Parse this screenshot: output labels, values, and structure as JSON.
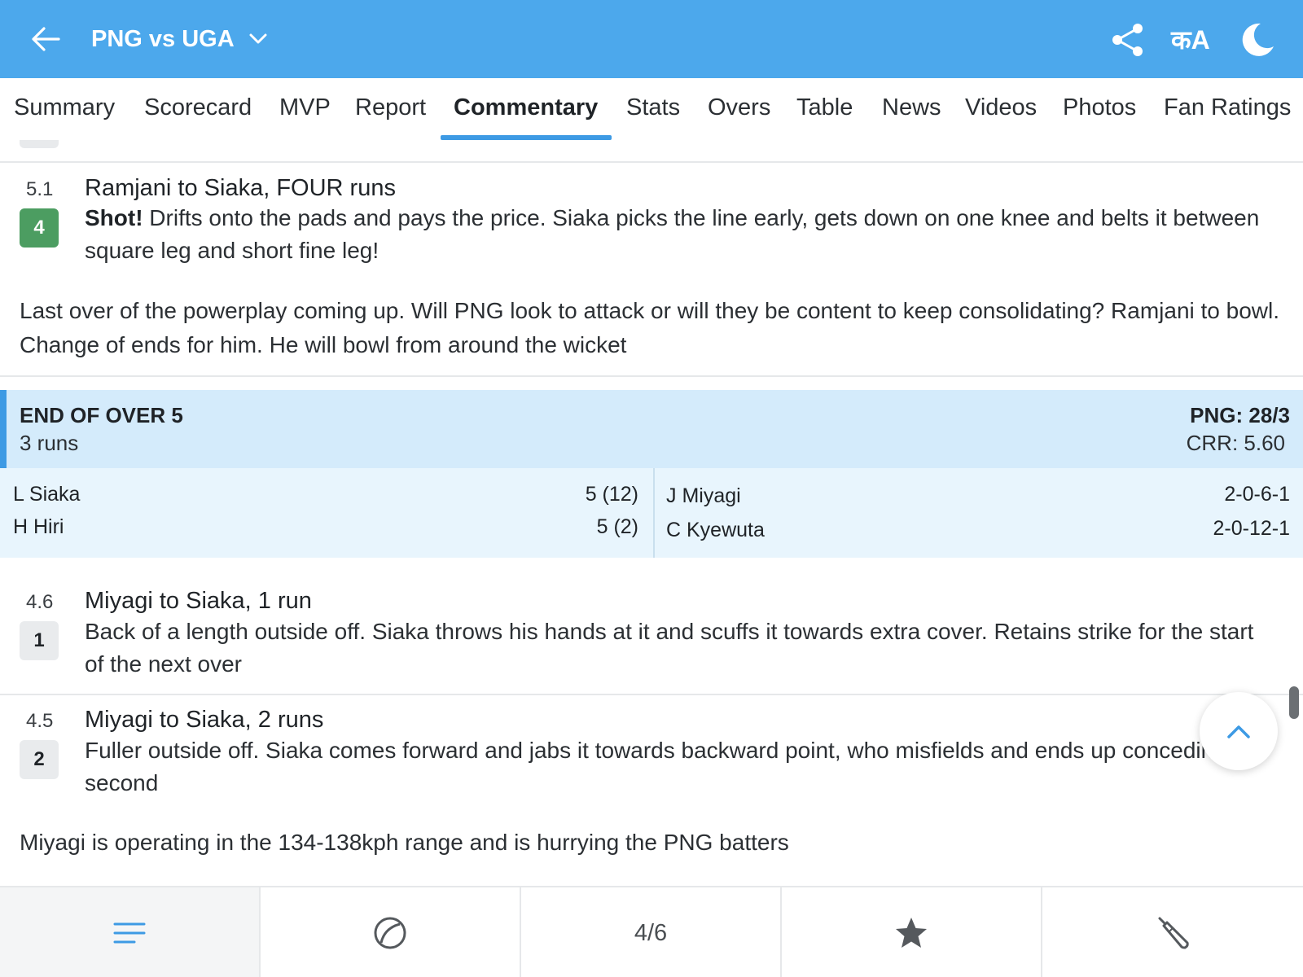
{
  "header": {
    "title": "PNG vs UGA",
    "language_label": "कA"
  },
  "tabs": [
    {
      "label": "Summary"
    },
    {
      "label": "Scorecard"
    },
    {
      "label": "MVP"
    },
    {
      "label": "Report"
    },
    {
      "label": "Commentary",
      "active": true
    },
    {
      "label": "Stats"
    },
    {
      "label": "Overs"
    },
    {
      "label": "Table"
    },
    {
      "label": "News"
    },
    {
      "label": "Videos"
    },
    {
      "label": "Photos"
    },
    {
      "label": "Fan Ratings"
    }
  ],
  "commentary": {
    "ball_5_1": {
      "over": "5.1",
      "runs": "4",
      "title": "Ramjani to Siaka, FOUR runs",
      "emphasis": "Shot!",
      "text": " Drifts onto the pads and pays the price. Siaka picks the line early, gets down on one knee and belts it between square leg and short fine leg!"
    },
    "note_1": "Last over of the powerplay coming up. Will PNG look to attack or will they be content to keep consolidating? Ramjani to bowl. Change of ends for him. He will bowl from around the wicket",
    "end_of_over": {
      "title": "END OF OVER 5",
      "runs": "3 runs",
      "score": "PNG: 28/3",
      "crr": "CRR: 5.60",
      "batters": [
        {
          "name": "L Siaka",
          "value": "5 (12)"
        },
        {
          "name": "H Hiri",
          "value": "5 (2)"
        }
      ],
      "bowlers": [
        {
          "name": "J Miyagi",
          "value": "2-0-6-1"
        },
        {
          "name": "C Kyewuta",
          "value": "2-0-12-1"
        }
      ]
    },
    "ball_4_6": {
      "over": "4.6",
      "runs": "1",
      "title": "Miyagi to Siaka, 1 run",
      "text": "Back of a length outside off. Siaka throws his hands at it and scuffs it towards extra cover. Retains strike for the start of the next over"
    },
    "ball_4_5": {
      "over": "4.5",
      "runs": "2",
      "title": "Miyagi to Siaka, 2 runs",
      "text": "Fuller outside off. Siaka comes forward and jabs it towards backward point, who misfields and ends up conceding the second"
    },
    "note_2": "Miyagi is operating in the 134-138kph range and is hurrying the PNG batters"
  },
  "bottom_bar": {
    "innings_counter": "4/6"
  },
  "colors": {
    "header_bg": "#4ca8ec",
    "accent": "#3d9ae4",
    "four_badge": "#4c9d61",
    "end_over_bg": "#d4ebfb"
  }
}
